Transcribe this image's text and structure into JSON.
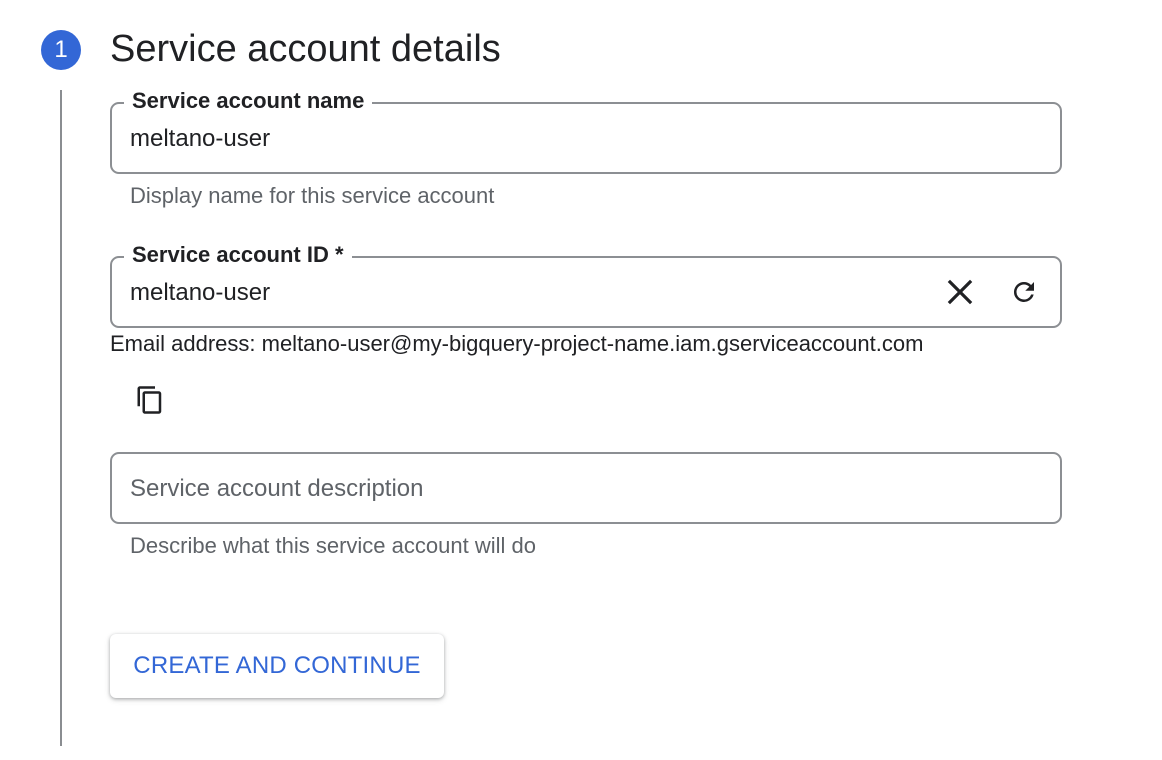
{
  "step": {
    "number": "1",
    "title": "Service account details",
    "badge_color": "#3367d6"
  },
  "fields": {
    "name": {
      "label": "Service account name",
      "value": "meltano-user",
      "hint": "Display name for this service account"
    },
    "id": {
      "label": "Service account ID *",
      "value": "meltano-user",
      "clear_icon": "close-icon",
      "refresh_icon": "refresh-icon"
    },
    "email": {
      "text": "Email address: meltano-user@my-bigquery-project-name.iam.gserviceaccount.com",
      "copy_icon": "copy-icon"
    },
    "description": {
      "placeholder": "Service account description",
      "hint": "Describe what this service account will do"
    }
  },
  "actions": {
    "create_label": "CREATE AND CONTINUE",
    "accent_color": "#3367d6"
  }
}
